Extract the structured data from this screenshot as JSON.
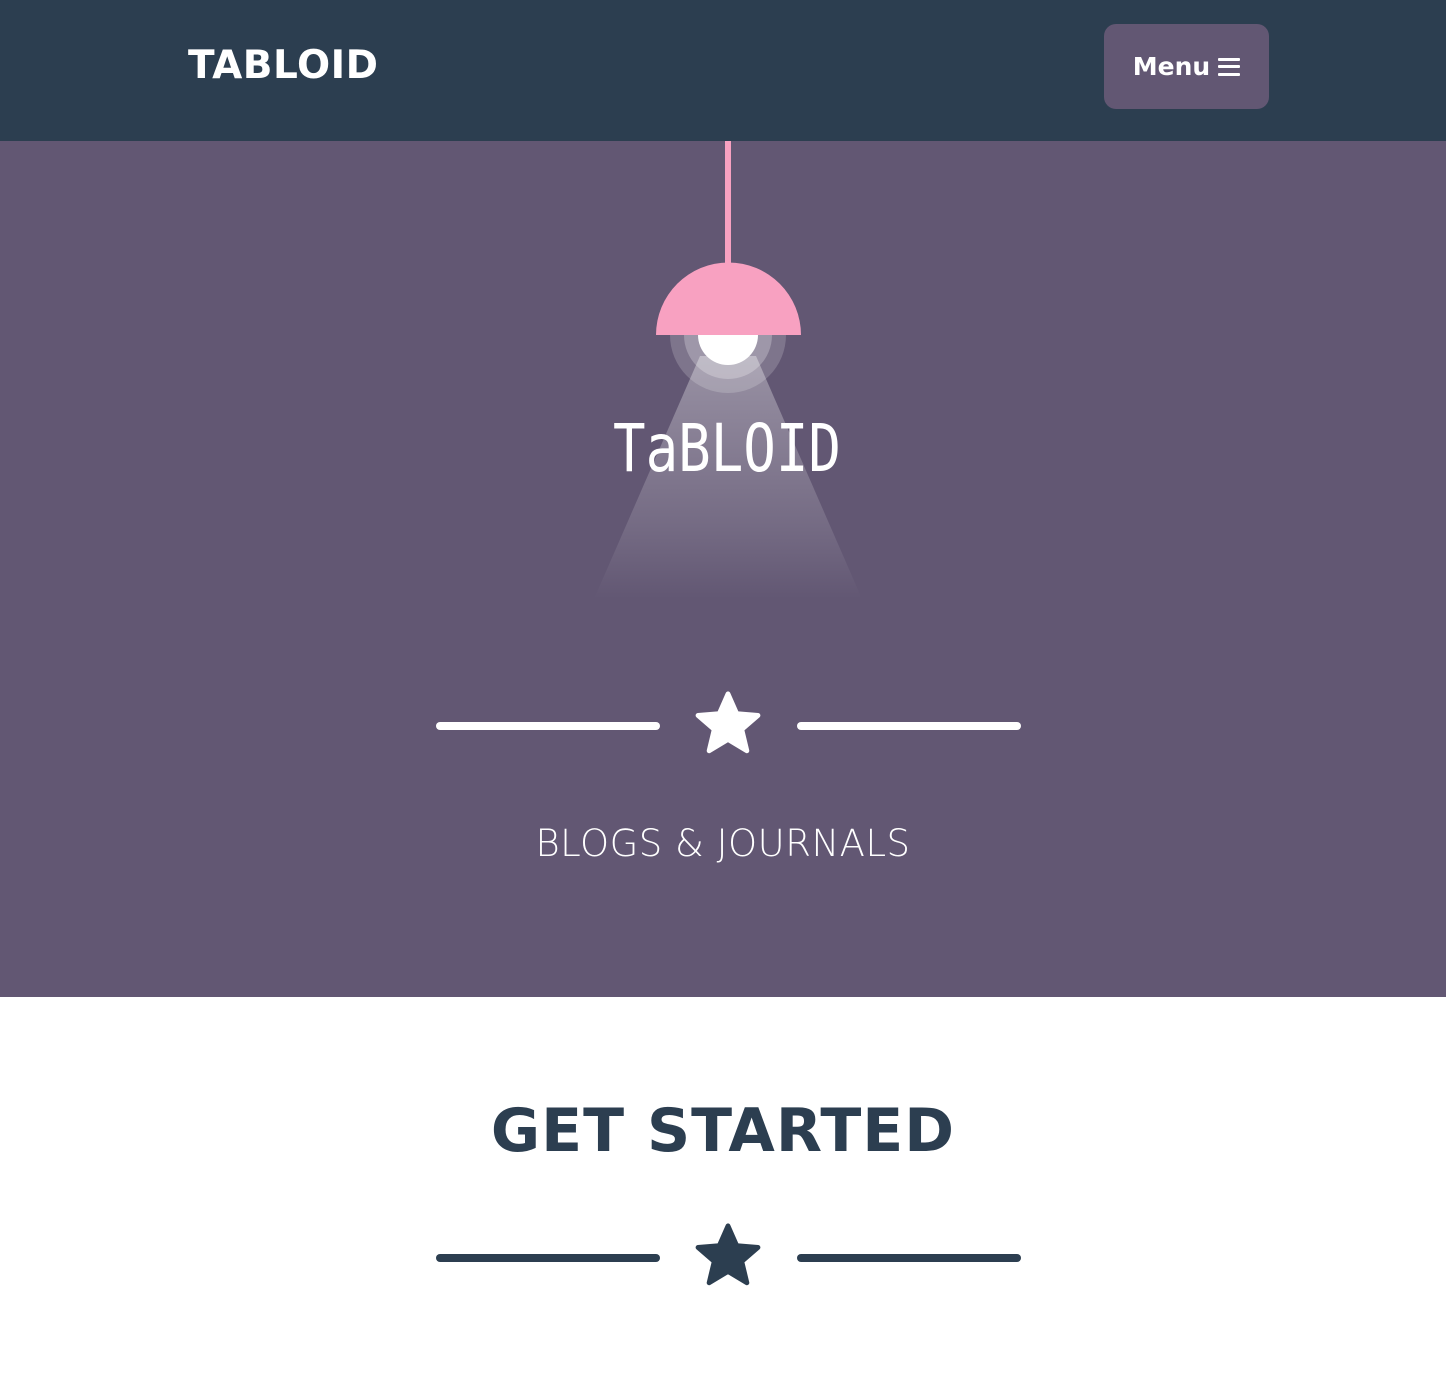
{
  "navbar": {
    "brand": "TABLOID",
    "menu_label": "Menu"
  },
  "masthead": {
    "logo_text": "TaBLOID",
    "subtitle": "BLOGS & JOURNALS"
  },
  "section": {
    "title": "GET STARTED"
  },
  "icons": {
    "menu": "bars-icon",
    "divider_star": "star-icon",
    "logo": "lamp-logo"
  },
  "colors": {
    "navbar_bg": "#2c3e50",
    "masthead_bg": "#625773",
    "lamp_shade": "#f8a1c1",
    "heading_text": "#2c3e50",
    "light_text": "#ffffff"
  }
}
